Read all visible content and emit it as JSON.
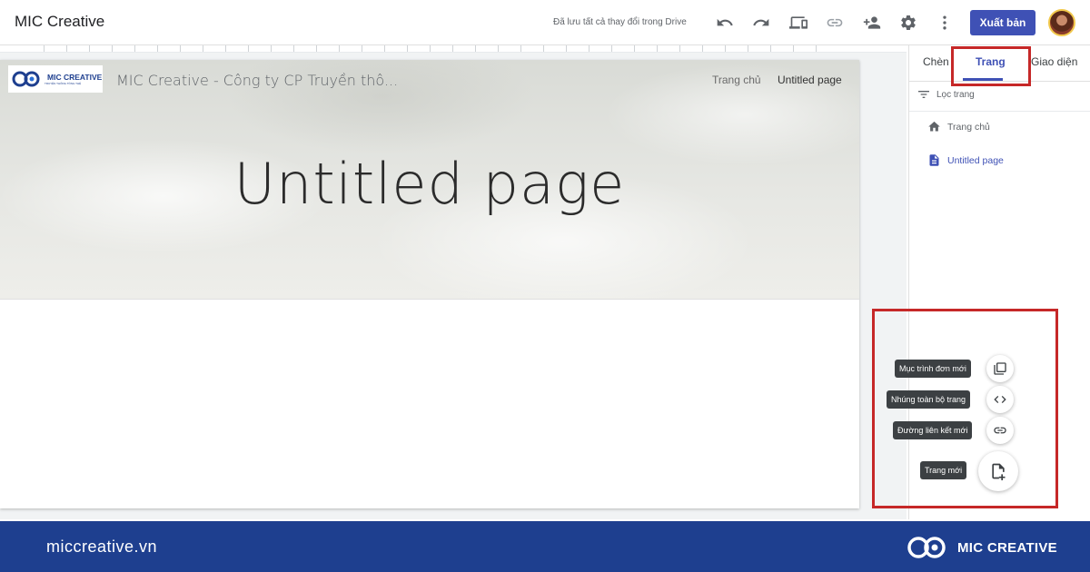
{
  "app": {
    "title": "MIC Creative",
    "save_status": "Đã lưu tất cả thay đổi trong Drive",
    "publish_label": "Xuất bản",
    "toolbar_icons": [
      "undo-icon",
      "redo-icon",
      "preview-icon",
      "link-icon",
      "share-icon",
      "settings-icon",
      "more-icon"
    ]
  },
  "site": {
    "logo_text": "MIC CREATIVE",
    "logo_subtext": "TRUYỀN THÔNG TỔNG THỂ",
    "name": "MIC Creative - Công ty CP Truyền thô...",
    "nav": {
      "home": "Trang chủ",
      "current": "Untitled page"
    },
    "hero_title": "Untitled page"
  },
  "panel": {
    "tabs": [
      "Chèn",
      "Trang",
      "Giao diện"
    ],
    "active_tab": "Trang",
    "filter_label": "Lọc trang",
    "pages": [
      {
        "label": "Trang chủ",
        "icon": "home-icon"
      },
      {
        "label": "Untitled page",
        "icon": "document-icon",
        "selected": true
      }
    ]
  },
  "add_menu": {
    "items": [
      {
        "label": "Mục trình đơn mới",
        "icon": "copy-icon"
      },
      {
        "label": "Nhúng toàn bộ trang",
        "icon": "code-icon"
      },
      {
        "label": "Đường liên kết mới",
        "icon": "link-icon"
      },
      {
        "label": "Trang mới",
        "icon": "new-page-icon"
      }
    ]
  },
  "footer": {
    "url": "miccreative.vn",
    "brand": "MIC CREATIVE"
  },
  "colors": {
    "accent": "#3f51b5",
    "highlight": "#c62828",
    "footer_bg": "#1e3f8f"
  }
}
